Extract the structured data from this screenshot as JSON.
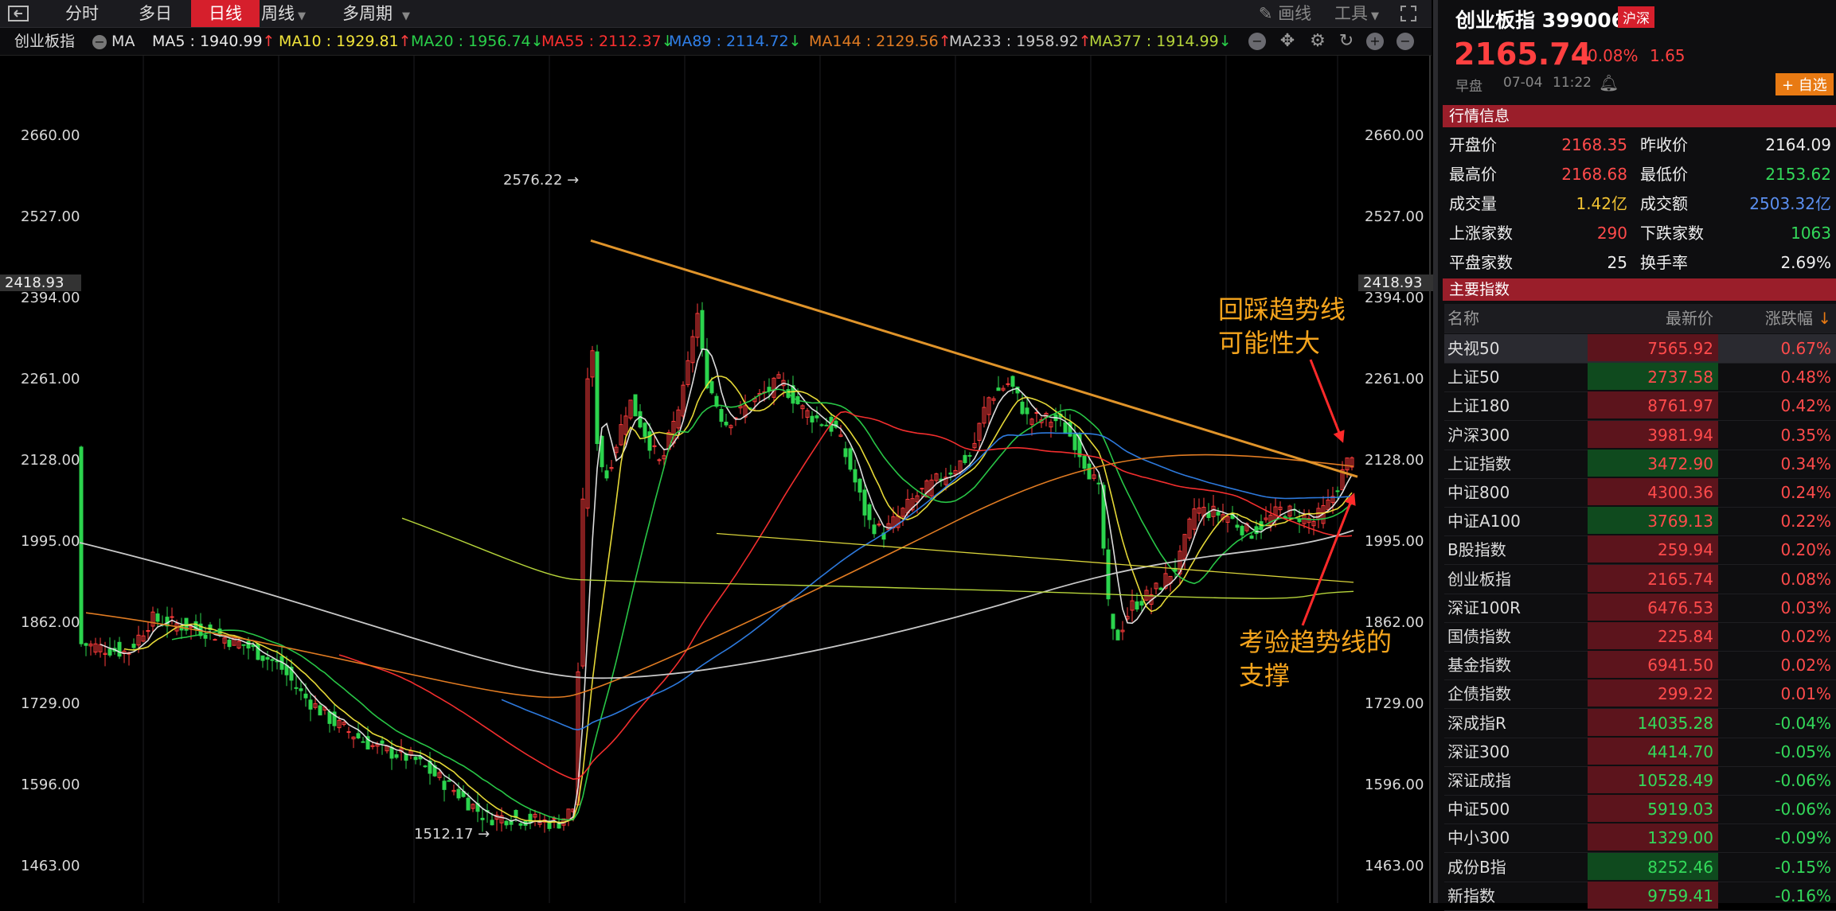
{
  "toolbar": {
    "tabs": [
      {
        "label": "分时",
        "active": false
      },
      {
        "label": "多日",
        "active": false
      },
      {
        "label": "日线",
        "active": true
      },
      {
        "label": "周线",
        "active": false
      },
      {
        "label": "多周期",
        "active": false
      }
    ],
    "draw_label": "画线",
    "tools_label": "工具"
  },
  "ma_bar": {
    "index_name": "创业板指",
    "ma_label": "MA",
    "items": [
      {
        "text": "MA5 : 1940.99",
        "arrow": "↑",
        "color": "#e8e8e8"
      },
      {
        "text": "MA10 : 1929.81",
        "arrow": "↑",
        "color": "#f1e43a"
      },
      {
        "text": "MA20 : 1956.74",
        "arrow": "↓",
        "color": "#2ad04a"
      },
      {
        "text": "MA55 : 2112.37",
        "arrow": "↓",
        "color": "#ff3030"
      },
      {
        "text": "MA89 : 2114.72",
        "arrow": "↓",
        "color": "#2f7fe8"
      },
      {
        "text": "MA144 : 2129.56",
        "arrow": "↑",
        "color": "#e07b22"
      },
      {
        "text": "MA233 : 1958.92",
        "arrow": "↑",
        "color": "#c8c8c8"
      },
      {
        "text": "MA377 : 1914.99",
        "arrow": "↓",
        "color": "#b6d43a"
      }
    ]
  },
  "chart_data": {
    "type": "candlestick",
    "y_ticks": [
      "2660.00",
      "2527.00",
      "2394.00",
      "2261.00",
      "2128.00",
      "1995.00",
      "1862.00",
      "1729.00",
      "1596.00",
      "1463.00"
    ],
    "ylim": [
      1440,
      2720
    ],
    "crosshair_value": "2418.93",
    "high_label": "2576.22",
    "low_label": "1512.17",
    "annotations": [
      {
        "lines": [
          "回踩趋势线",
          "可能性大"
        ]
      },
      {
        "lines": [
          "考验趋势线的",
          "支撑"
        ]
      }
    ],
    "colors": {
      "up": "#ff3b3b",
      "down": "#2bd44d",
      "trend": "#e0942a",
      "arrow": "#ff2a2a"
    }
  },
  "panel": {
    "title": "创业板指 399006",
    "market_badge": "沪深",
    "price": "2165.74",
    "change_pct": "0.08%",
    "change": "1.65",
    "session": "早盘",
    "date": "07-04",
    "time": "11:22",
    "watch_label": "+ 自选",
    "quote_section": "行情信息",
    "quotes": [
      [
        {
          "k": "开盘价",
          "v": "2168.35",
          "c": "red"
        },
        {
          "k": "昨收价",
          "v": "2164.09",
          "c": "white"
        }
      ],
      [
        {
          "k": "最高价",
          "v": "2168.68",
          "c": "red"
        },
        {
          "k": "最低价",
          "v": "2153.62",
          "c": "green"
        }
      ],
      [
        {
          "k": "成交量",
          "v": "1.42亿",
          "c": "yellow"
        },
        {
          "k": "成交额",
          "v": "2503.32亿",
          "c": "blue"
        }
      ],
      [
        {
          "k": "上涨家数",
          "v": "290",
          "c": "red"
        },
        {
          "k": "下跌家数",
          "v": "1063",
          "c": "green"
        }
      ],
      [
        {
          "k": "平盘家数",
          "v": "25",
          "c": "white"
        },
        {
          "k": "换手率",
          "v": "2.69%",
          "c": "white"
        }
      ]
    ],
    "index_section": "主要指数",
    "index_headers": {
      "name": "名称",
      "price": "最新价",
      "change": "涨跌幅"
    },
    "indices": [
      {
        "name": "央视50",
        "price": "7565.92",
        "pct": "0.67%",
        "dir": "up"
      },
      {
        "name": "上证50",
        "price": "2737.58",
        "pct": "0.48%",
        "dir": "down"
      },
      {
        "name": "上证180",
        "price": "8761.97",
        "pct": "0.42%",
        "dir": "up"
      },
      {
        "name": "沪深300",
        "price": "3981.94",
        "pct": "0.35%",
        "dir": "up"
      },
      {
        "name": "上证指数",
        "price": "3472.90",
        "pct": "0.34%",
        "dir": "down"
      },
      {
        "name": "中证800",
        "price": "4300.36",
        "pct": "0.24%",
        "dir": "up"
      },
      {
        "name": "中证A100",
        "price": "3769.13",
        "pct": "0.22%",
        "dir": "down"
      },
      {
        "name": "B股指数",
        "price": "259.94",
        "pct": "0.20%",
        "dir": "up"
      },
      {
        "name": "创业板指",
        "price": "2165.74",
        "pct": "0.08%",
        "dir": "up"
      },
      {
        "name": "深证100R",
        "price": "6476.53",
        "pct": "0.03%",
        "dir": "up"
      },
      {
        "name": "国债指数",
        "price": "225.84",
        "pct": "0.02%",
        "dir": "up"
      },
      {
        "name": "基金指数",
        "price": "6941.50",
        "pct": "0.02%",
        "dir": "up"
      },
      {
        "name": "企债指数",
        "price": "299.22",
        "pct": "0.01%",
        "dir": "up"
      },
      {
        "name": "深成指R",
        "price": "14035.28",
        "pct": "-0.04%",
        "dir": "up"
      },
      {
        "name": "深证300",
        "price": "4414.70",
        "pct": "-0.05%",
        "dir": "up"
      },
      {
        "name": "深证成指",
        "price": "10528.49",
        "pct": "-0.06%",
        "dir": "up"
      },
      {
        "name": "中证500",
        "price": "5919.03",
        "pct": "-0.06%",
        "dir": "up"
      },
      {
        "name": "中小300",
        "price": "1329.00",
        "pct": "-0.09%",
        "dir": "up"
      },
      {
        "name": "成份B指",
        "price": "8252.46",
        "pct": "-0.15%",
        "dir": "down"
      },
      {
        "name": "新指数",
        "price": "9759.41",
        "pct": "-0.16%",
        "dir": "up"
      }
    ]
  }
}
